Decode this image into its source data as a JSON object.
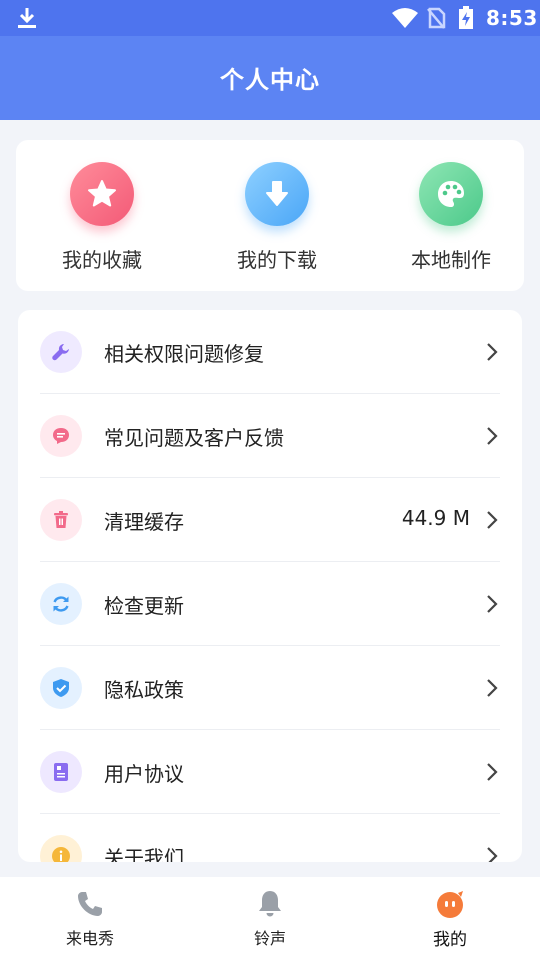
{
  "status_bar": {
    "time": "8:53",
    "icons": [
      "download-icon",
      "wifi-icon",
      "no-sim-icon",
      "battery-charging-icon"
    ]
  },
  "header": {
    "title": "个人中心"
  },
  "quick_actions": [
    {
      "label": "我的收藏",
      "icon": "star-icon",
      "color": "#f35a77"
    },
    {
      "label": "我的下载",
      "icon": "download-arrow-icon",
      "color": "#4aa6f7"
    },
    {
      "label": "本地制作",
      "icon": "palette-icon",
      "color": "#4cc98a"
    }
  ],
  "menu": [
    {
      "label": "相关权限问题修复",
      "icon": "wrench-icon",
      "icon_color": "#8a6cf0",
      "value": ""
    },
    {
      "label": "常见问题及客户反馈",
      "icon": "chat-bubble-icon",
      "icon_color": "#f26a8a",
      "value": ""
    },
    {
      "label": "清理缓存",
      "icon": "trash-icon",
      "icon_color": "#f26a8a",
      "value": "44.9 M"
    },
    {
      "label": "检查更新",
      "icon": "refresh-icon",
      "icon_color": "#3e9af0",
      "value": ""
    },
    {
      "label": "隐私政策",
      "icon": "shield-check-icon",
      "icon_color": "#3e9af0",
      "value": ""
    },
    {
      "label": "用户协议",
      "icon": "document-icon",
      "icon_color": "#8a6cf0",
      "value": ""
    },
    {
      "label": "关于我们",
      "icon": "info-icon",
      "icon_color": "#f5b73a",
      "value": ""
    }
  ],
  "tabs": [
    {
      "label": "来电秀",
      "icon": "phone-icon",
      "active": false
    },
    {
      "label": "铃声",
      "icon": "bell-icon",
      "active": false
    },
    {
      "label": "我的",
      "icon": "mascot-icon",
      "active": true
    }
  ]
}
